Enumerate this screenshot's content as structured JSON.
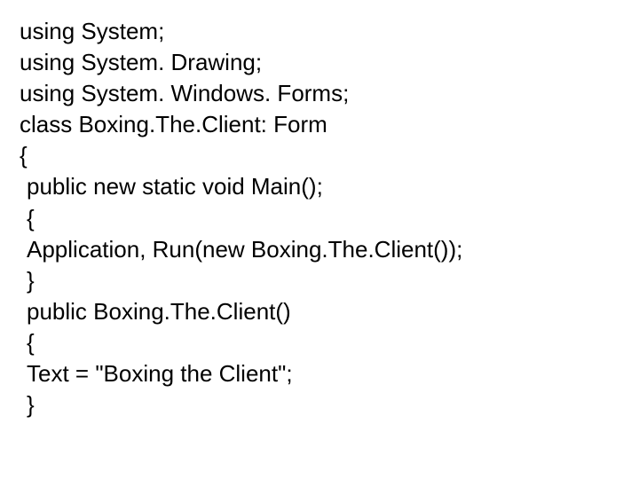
{
  "code": {
    "lines": [
      {
        "text": "using System;",
        "indent": 0
      },
      {
        "text": "using System. Drawing;",
        "indent": 0
      },
      {
        "text": "using System. Windows. Forms;",
        "indent": 0
      },
      {
        "text": "class Boxing.The.Client: Form",
        "indent": 0
      },
      {
        "text": "{",
        "indent": 0
      },
      {
        "text": "public new static void Main();",
        "indent": 1
      },
      {
        "text": "{",
        "indent": 1
      },
      {
        "text": "Application, Run(new Boxing.The.Client());",
        "indent": 1
      },
      {
        "text": "}",
        "indent": 1
      },
      {
        "text": "public Boxing.The.Client()",
        "indent": 1
      },
      {
        "text": "{",
        "indent": 1
      },
      {
        "text": "Text = \"Boxing the Client\";",
        "indent": 1
      },
      {
        "text": "}",
        "indent": 1
      }
    ]
  }
}
